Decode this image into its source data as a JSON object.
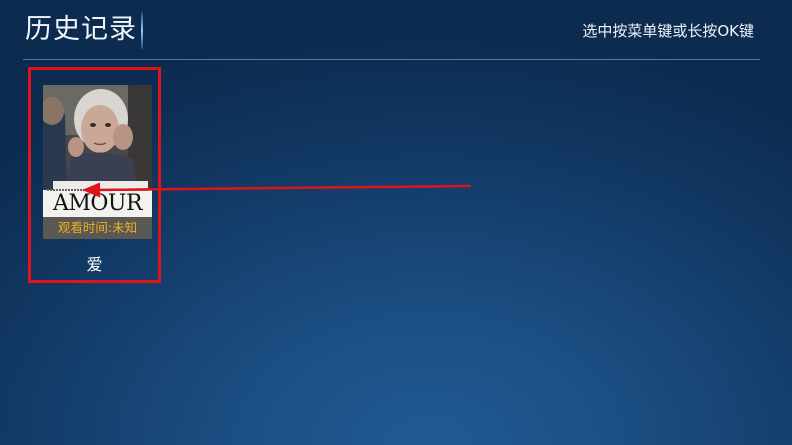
{
  "header": {
    "title": "历史记录",
    "hint": "选中按菜单键或长按OK键"
  },
  "history": {
    "items": [
      {
        "poster_title": "AMOUR",
        "watch_time": "观看时间:未知",
        "name": "爱"
      }
    ]
  },
  "colors": {
    "selection_border": "#e0131d",
    "watch_time_text": "#f0b020",
    "annotation_arrow": "#e0131d"
  }
}
